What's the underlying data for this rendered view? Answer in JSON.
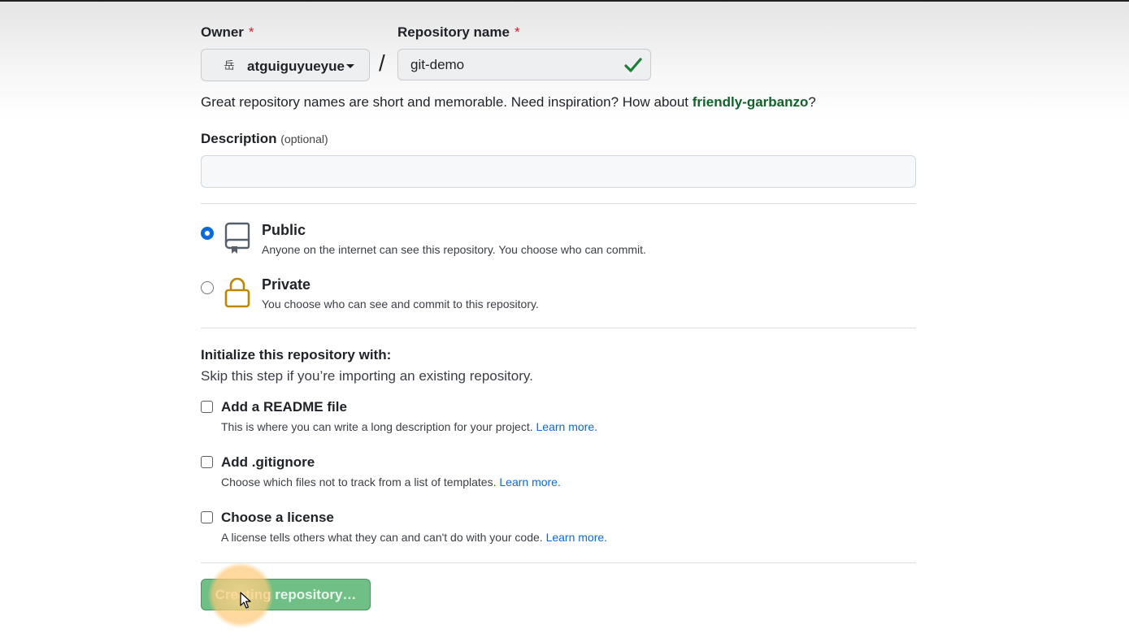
{
  "owner": {
    "label": "Owner",
    "required_mark": "*",
    "avatar_glyph": "岳",
    "name": "atguiguyueyue"
  },
  "separator": "/",
  "repo": {
    "label": "Repository name",
    "required_mark": "*",
    "value": "git-demo",
    "status_icon": "check-icon"
  },
  "hint": {
    "prefix": "Great repository names are short and memorable. Need inspiration? How about ",
    "suggestion": "friendly-garbanzo",
    "suffix": "?"
  },
  "description": {
    "label": "Description",
    "optional": "(optional)",
    "value": ""
  },
  "visibility": {
    "selected": "public",
    "public": {
      "title": "Public",
      "desc": "Anyone on the internet can see this repository. You choose who can commit.",
      "icon": "repo-icon"
    },
    "private": {
      "title": "Private",
      "desc": "You choose who can see and commit to this repository.",
      "icon": "lock-icon"
    }
  },
  "init": {
    "title": "Initialize this repository with:",
    "subtitle": "Skip this step if you’re importing an existing repository.",
    "readme": {
      "title": "Add a README file",
      "desc": "This is where you can write a long description for your project. ",
      "link": "Learn more.",
      "checked": false
    },
    "gitignore": {
      "title": "Add .gitignore",
      "desc": "Choose which files not to track from a list of templates. ",
      "link": "Learn more.",
      "checked": false
    },
    "license": {
      "title": "Choose a license",
      "desc": "A license tells others what they can and can't do with your code. ",
      "link": "Learn more.",
      "checked": false
    }
  },
  "submit": {
    "label": "Creating repository…"
  },
  "colors": {
    "success": "#1a7f37",
    "link": "#0969da",
    "required": "#cf222e",
    "lock": "#bf8700"
  }
}
